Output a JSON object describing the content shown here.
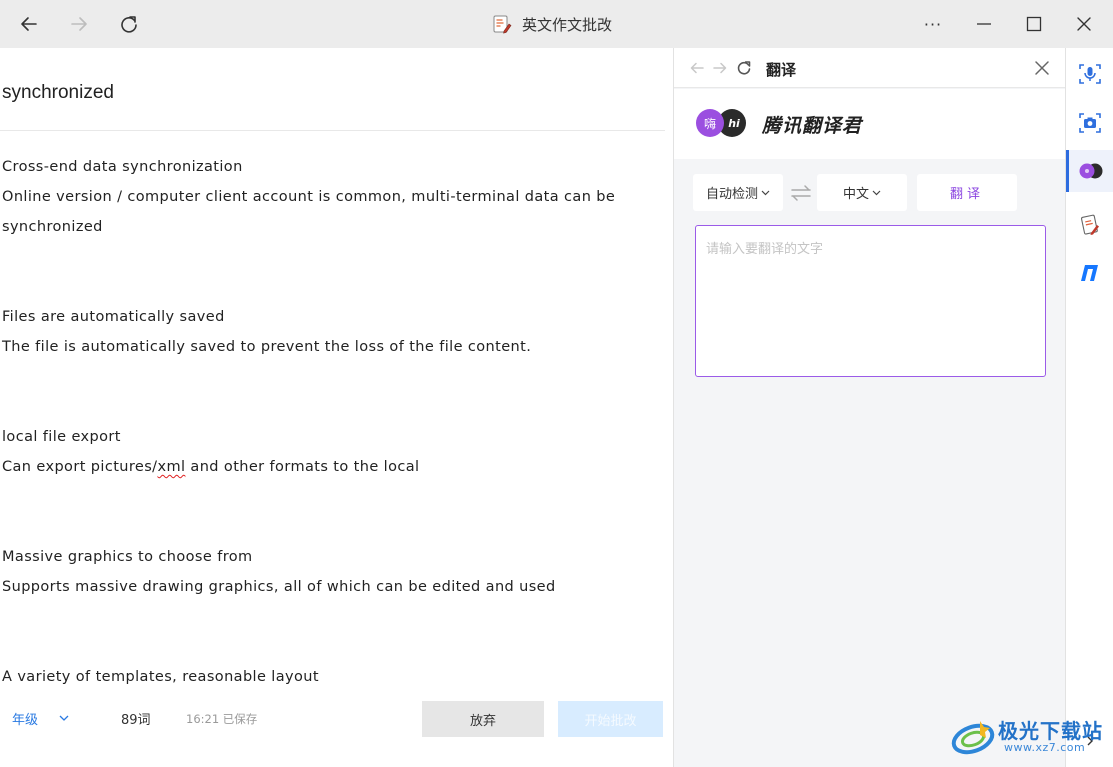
{
  "window": {
    "title": "英文作文批改",
    "more_label": "···"
  },
  "editor": {
    "title": "synchronized",
    "paragraphs": [
      {
        "heading": "Cross-end data synchronization",
        "lines": [
          "Online version / computer client account is common, multi-terminal data can be",
          "synchronized"
        ]
      },
      {
        "heading": "Files are automatically saved",
        "lines": [
          "The file is automatically saved to prevent the loss of the file content."
        ]
      },
      {
        "heading": "local file export",
        "line_before": "Can export pictures/",
        "line_flagged": "xml",
        "line_after": " and other formats to the local"
      },
      {
        "heading": "Massive graphics to choose from",
        "lines": [
          "Supports massive drawing graphics, all of which can be edited and used"
        ]
      },
      {
        "heading": "A variety of templates, reasonable layout"
      }
    ]
  },
  "bottombar": {
    "grade_label": "年级",
    "word_count": "89词",
    "saved_status": "16:21 已保存",
    "discard_label": "放弃",
    "start_label": "开始批改"
  },
  "translate_panel": {
    "title": "翻译",
    "brand_name": "腾讯翻译君",
    "logo_left": "嗨",
    "logo_right": "hi",
    "source_lang": "自动检测",
    "target_lang": "中文",
    "translate_label": "翻译",
    "input_placeholder": "请输入要翻译的文字",
    "input_value": "",
    "accent_color": "#9b5be8"
  },
  "rail": {
    "items": [
      "microphone-icon",
      "camera-icon",
      "tencent-translate-icon",
      "essay-card-icon",
      "blue-app-icon"
    ],
    "active_index": 2,
    "active_color": "#2d6cdf"
  },
  "watermark": {
    "name": "极光下载站",
    "url": "www.xz7.com"
  }
}
